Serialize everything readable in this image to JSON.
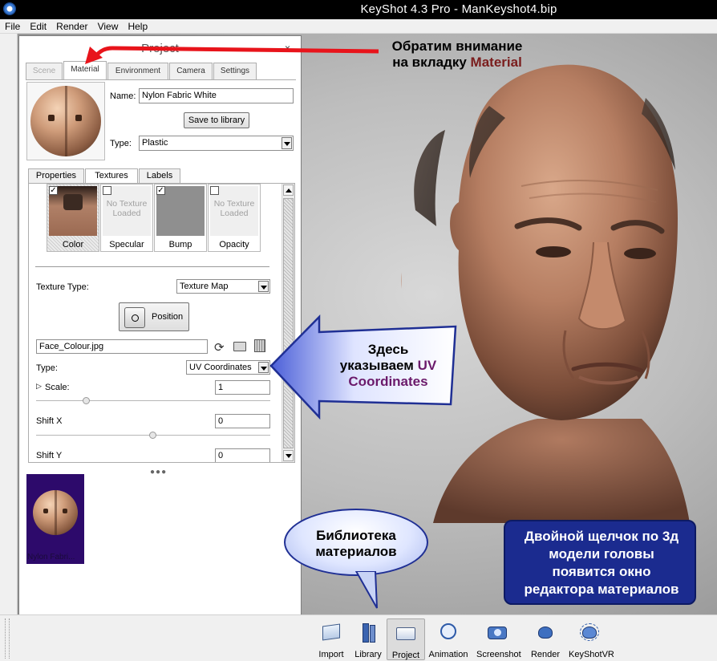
{
  "window": {
    "title": "KeyShot 4.3 Pro  - ManKeyshot4.bip"
  },
  "menu": [
    "File",
    "Edit",
    "Render",
    "View",
    "Help"
  ],
  "project_panel": {
    "title": "Project",
    "close": "×",
    "tabs": [
      "Scene",
      "Material",
      "Environment",
      "Camera",
      "Settings"
    ],
    "name_label": "Name:",
    "name_value": "Nylon Fabric White",
    "save_button": "Save to library",
    "type_label": "Type:",
    "type_value": "Plastic",
    "subtabs": [
      "Properties",
      "Textures",
      "Labels"
    ],
    "texture_slots": [
      {
        "label": "Color",
        "checked": true,
        "empty_text": ""
      },
      {
        "label": "Specular",
        "checked": false,
        "empty_text": "No Texture Loaded"
      },
      {
        "label": "Bump",
        "checked": true,
        "empty_text": ""
      },
      {
        "label": "Opacity",
        "checked": false,
        "empty_text": "No Texture Loaded"
      }
    ],
    "texture_type_label": "Texture Type:",
    "texture_type_value": "Texture Map",
    "position_button": "Position",
    "file_value": "Face_Colour.jpg",
    "mapping_type_label": "Type:",
    "mapping_type_value": "UV Coordinates",
    "scale_label": "Scale:",
    "scale_value": "1",
    "shiftx_label": "Shift X",
    "shiftx_value": "0",
    "shifty_label": "Shift Y",
    "shifty_value": "0",
    "library_item": "Nylon Fabri..."
  },
  "toolbar": [
    "Import",
    "Library",
    "Project",
    "Animation",
    "Screenshot",
    "Render",
    "KeyShotVR"
  ],
  "annotations": {
    "material_note_line1": "Обратим внимание",
    "material_note_line2_prefix": "на вкладку ",
    "material_note_line2_accent": "Material",
    "uv_note_line1": "Здесь",
    "uv_note_line2_prefix": "указываем ",
    "uv_note_line2_accent": "UV",
    "uv_note_line3": "Coordinates",
    "library_note_line1": "Библиотека",
    "library_note_line2": "материалов",
    "info_line1": "Двойной щелчок по 3д",
    "info_line2": "модели головы",
    "info_line3": "появится окно",
    "info_line4": "редактора материалов"
  },
  "colors": {
    "arrow_red": "#e8141b",
    "callout_blue": "#1f2f94",
    "infobox_blue": "#1b2b8f",
    "library_bg": "#2d0a6b",
    "accent_material": "#7a1d1d",
    "accent_uv": "#6b1a6b"
  }
}
